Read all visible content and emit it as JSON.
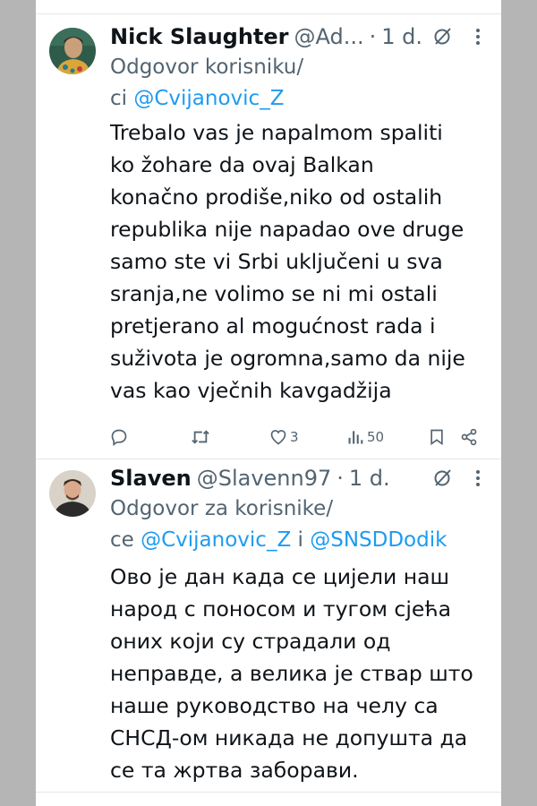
{
  "tweets": [
    {
      "name": "Nick Slaughter",
      "handle": "@Ad...",
      "separator": "·",
      "time": "1 d.",
      "reply_prefix": "Odgovor korisniku/",
      "reply_conj": "ci",
      "mentions": [
        "@Cvijanovic_Z"
      ],
      "body": "Trebalo vas je napalmom spaliti\nko žohare da ovaj Balkan\nkonačno prodiše,niko od ostalih\nrepublika nije napadao ove druge\nsamo ste vi Srbi uključeni u sva\nsranja,ne volimo se ni mi ostali\npretjerano al mogućnost rada i\nsuživota je ogromna,samo da nije\nvas kao vječnih kavgadžija",
      "likes": "3",
      "views": "50"
    },
    {
      "name": "Slaven",
      "handle": "@Slavenn97",
      "separator": "·",
      "time": "1 d.",
      "reply_prefix": "Odgovor za korisnike/",
      "reply_conj": "ce",
      "mentions": [
        "@Cvijanovic_Z",
        "@SNSDDodik"
      ],
      "mention_joiner": "i",
      "body": "Ово је дан када се цијели наш\nнарод с поносом и тугом сјећа\nоних који су страдали од\nнеправде, а велика је ствар што\nнаше руководство на челу са\nСНСД-ом никада не допушта да\nсе та жртва заборави."
    }
  ],
  "icons": {
    "reply": "reply-icon",
    "retweet": "retweet-icon",
    "like": "like-icon",
    "views": "views-icon",
    "bookmark": "bookmark-icon",
    "share": "share-icon",
    "grok": "grok-icon",
    "more": "more-icon"
  },
  "colors": {
    "link": "#1d9bf0",
    "secondary_text": "#536471",
    "primary_text": "#0f1419",
    "outer_background": "#b5b5b5"
  }
}
